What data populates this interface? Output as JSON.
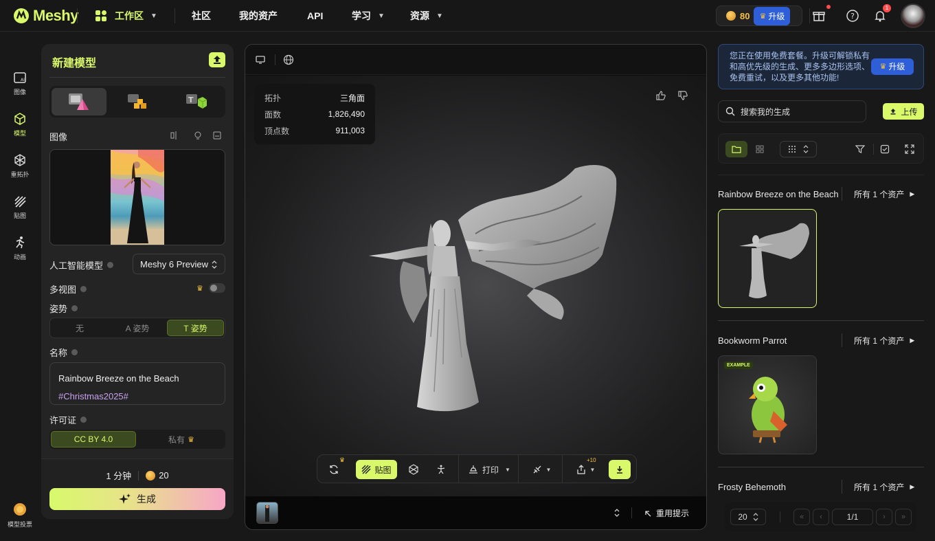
{
  "header": {
    "logo_text": "Meshy",
    "nav": [
      {
        "label": "工作区",
        "caret": true,
        "active": true
      },
      {
        "label": "社区"
      },
      {
        "label": "我的资产"
      },
      {
        "label": "API"
      },
      {
        "label": "学习",
        "caret": true
      },
      {
        "label": "资源",
        "caret": true
      }
    ],
    "credits": "80",
    "upgrade_label": "升级",
    "notification_count": "1"
  },
  "sidebar": {
    "items": [
      {
        "label": "图像",
        "icon": "image-ai-icon"
      },
      {
        "label": "模型",
        "icon": "cube-icon",
        "active": true
      },
      {
        "label": "重拓扑",
        "icon": "retopology-icon"
      },
      {
        "label": "贴图",
        "icon": "texture-icon"
      },
      {
        "label": "动画",
        "icon": "running-person-icon"
      }
    ],
    "bottom_label": "模型投票"
  },
  "left_panel": {
    "title": "新建模型",
    "image_label": "图像",
    "ai_model_label": "人工智能模型",
    "ai_model_value": "Meshy 6 Preview",
    "multiview_label": "多视图",
    "pose_label": "姿势",
    "pose_options": [
      "无",
      "A 姿势",
      "T 姿势"
    ],
    "pose_selected": "T 姿势",
    "name_label": "名称",
    "name_value": "Rainbow Breeze on the Beach",
    "name_tag": "#Christmas2025#",
    "license_label": "许可证",
    "license_options": [
      "CC BY 4.0",
      "私有"
    ],
    "time_estimate": "1 分钟",
    "cost": "20",
    "generate_label": "生成"
  },
  "viewer": {
    "stats": [
      {
        "label": "拓扑",
        "value": "三角面"
      },
      {
        "label": "面数",
        "value": "1,826,490"
      },
      {
        "label": "顶点数",
        "value": "911,003"
      }
    ],
    "toolbar": {
      "texture_label": "贴图",
      "print_label": "打印",
      "share_bonus": "+10"
    },
    "reuse_prompt_label": "重用提示"
  },
  "right_panel": {
    "promo_text": "您正在使用免费套餐。升级可解锁私有和高优先级的生成、更多多边形选项、免费重试，以及更多其他功能!",
    "promo_button": "升级",
    "search_placeholder": "搜索我的生成",
    "upload_label": "上传",
    "sections": [
      {
        "title": "Rainbow Breeze on the Beach",
        "all_label": "所有 1 个资产"
      },
      {
        "title": "Bookworm Parrot",
        "all_label": "所有 1 个资产",
        "badge": "EXAMPLE"
      },
      {
        "title": "Frosty Behemoth",
        "all_label": "所有 1 个资产"
      }
    ],
    "pagination": {
      "per_page": "20",
      "page": "1/1"
    }
  },
  "colors": {
    "accent": "#d9f86a",
    "upgrade_blue": "#2e5fd8",
    "panel": "#242424"
  }
}
